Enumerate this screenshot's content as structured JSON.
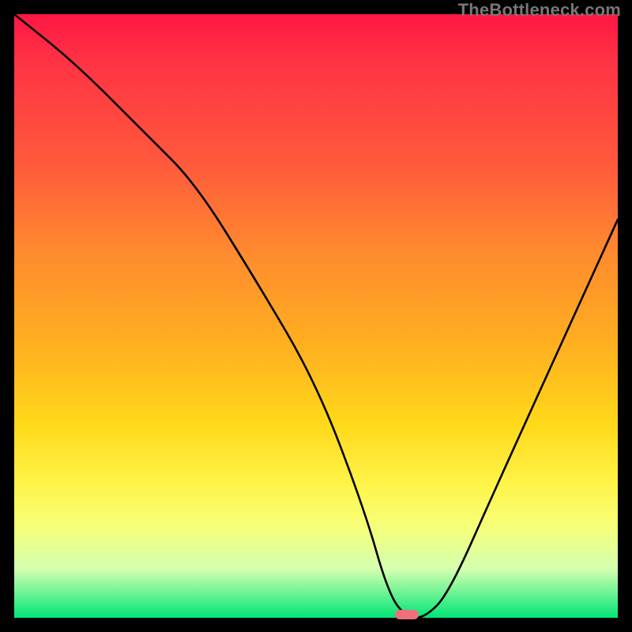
{
  "watermark": "TheBottleneck.com",
  "marker": {
    "x_pct": 65,
    "y_pct": 100
  },
  "chart_data": {
    "type": "line",
    "title": "",
    "xlabel": "",
    "ylabel": "",
    "xlim": [
      0,
      100
    ],
    "ylim": [
      0,
      100
    ],
    "series": [
      {
        "name": "curve",
        "x": [
          0,
          10,
          22,
          30,
          40,
          50,
          58,
          62,
          65,
          68,
          72,
          80,
          90,
          100
        ],
        "y": [
          100,
          92,
          80,
          72,
          56,
          39,
          18,
          4,
          0,
          0,
          4,
          22,
          44,
          66
        ]
      }
    ],
    "marker_point": {
      "x": 65,
      "y": 0
    },
    "background": "red-yellow-green vertical gradient",
    "grid": false,
    "legend": false
  }
}
